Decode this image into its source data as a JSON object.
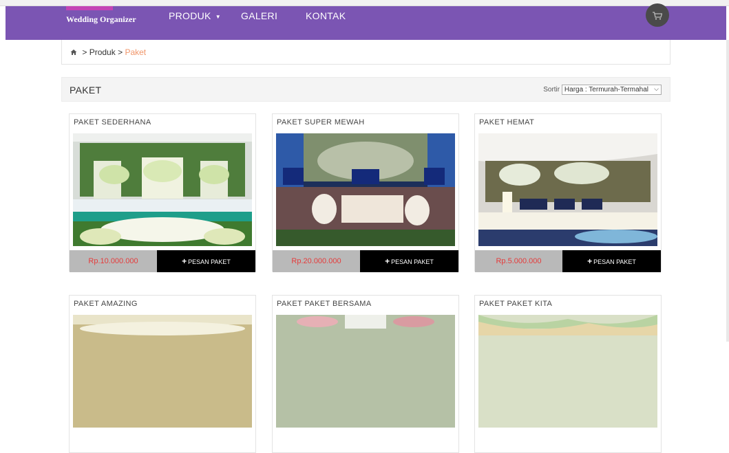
{
  "brand": {
    "subtitle": "Wedding Organizer"
  },
  "nav": {
    "items": [
      {
        "label": "PRODUK",
        "has_dropdown": true
      },
      {
        "label": "GALERI"
      },
      {
        "label": "KONTAK"
      }
    ],
    "cart_icon": "shopping-cart-icon"
  },
  "breadcrumb": {
    "home_icon": "home-icon",
    "sep": ">",
    "items": [
      "Produk",
      "Paket"
    ]
  },
  "section": {
    "title": "PAKET",
    "sort_label": "Sortir",
    "sort_value": "Harga : Termurah-Termahal"
  },
  "products": [
    {
      "name": "PAKET SEDERHANA",
      "price": "Rp.10.000.000",
      "order_label": "PESAN PAKET"
    },
    {
      "name": "PAKET SUPER MEWAH",
      "price": "Rp.20.000.000",
      "order_label": "PESAN PAKET"
    },
    {
      "name": "PAKET HEMAT",
      "price": "Rp.5.000.000",
      "order_label": "PESAN PAKET"
    },
    {
      "name": "PAKET AMAZING",
      "price": "",
      "order_label": ""
    },
    {
      "name": "PAKET PAKET BERSAMA",
      "price": "",
      "order_label": ""
    },
    {
      "name": "PAKET PAKET KITA",
      "price": "",
      "order_label": ""
    }
  ],
  "colors": {
    "navbar": "#7b55b3",
    "price_text": "#e53b3b",
    "breadcrumb_active": "#f0966a"
  }
}
